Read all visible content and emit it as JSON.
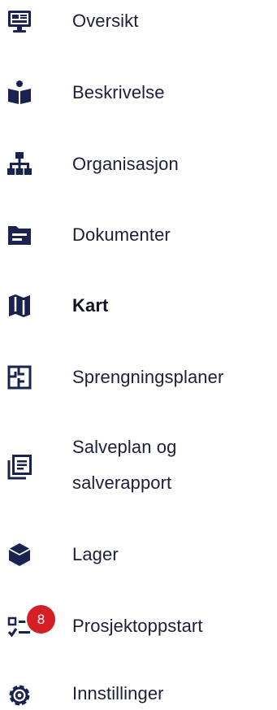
{
  "navigation": {
    "items": [
      {
        "label": "Oversikt",
        "icon": "dashboard-monitor-icon",
        "active": false
      },
      {
        "label": "Beskrivelse",
        "icon": "reading-person-icon",
        "active": false
      },
      {
        "label": "Organisasjon",
        "icon": "org-chart-icon",
        "active": false
      },
      {
        "label": "Dokumenter",
        "icon": "folder-icon",
        "active": false
      },
      {
        "label": "Kart",
        "icon": "map-icon",
        "active": true
      },
      {
        "label": "Sprengningsplaner",
        "icon": "floor-plan-icon",
        "active": false
      },
      {
        "label": "Salveplan og salverapport",
        "icon": "report-pages-icon",
        "active": false
      },
      {
        "label": "Lager",
        "icon": "cube-box-icon",
        "active": false
      },
      {
        "label": "Prosjektoppstart",
        "icon": "checklist-icon",
        "active": false,
        "badge": "8"
      },
      {
        "label": "Innstillinger",
        "icon": "gear-icon",
        "active": false
      }
    ]
  },
  "colors": {
    "icon": "#1a2250",
    "text": "#1b1f3a",
    "badge": "#d41f24"
  }
}
